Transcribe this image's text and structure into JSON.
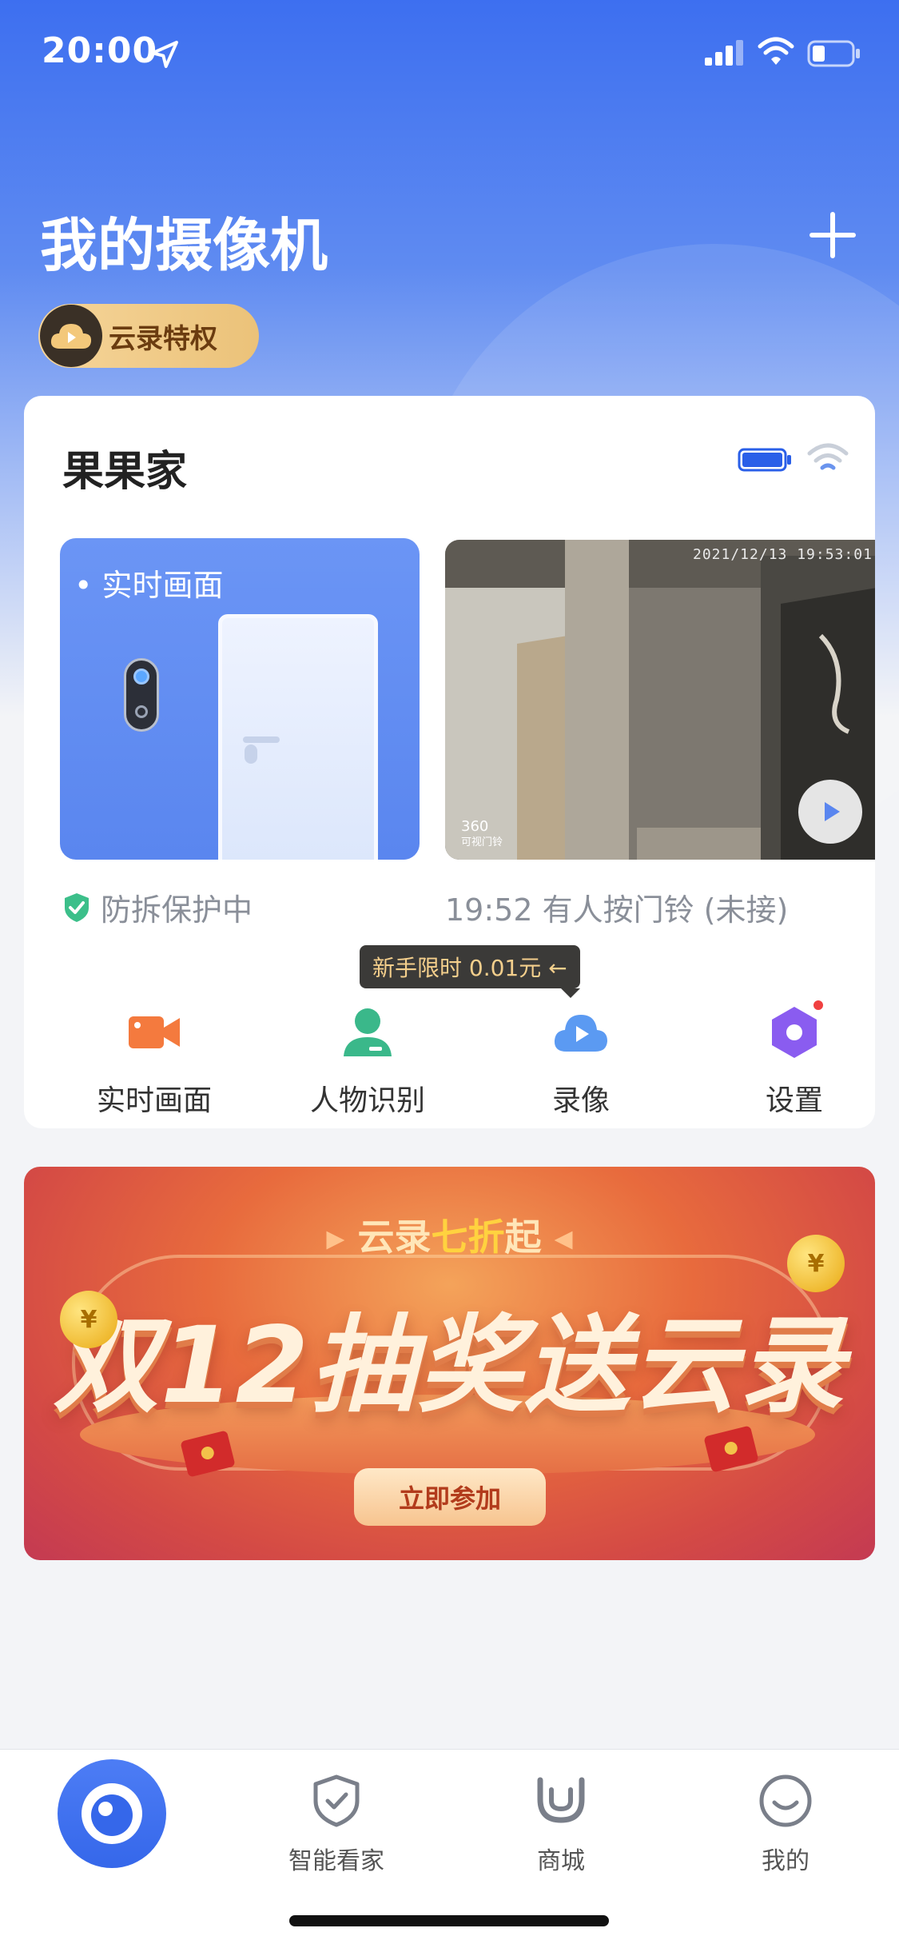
{
  "status_bar": {
    "time": "20:00"
  },
  "header": {
    "title": "我的摄像机",
    "cloud_badge": "云录特权"
  },
  "camera": {
    "name": "果果家",
    "live_tile_label": "实时画面",
    "protect_status": "防拆保护中",
    "last_event": "19:52 有人按门铃 (未接)",
    "recording_timestamp": "2021/12/13 19:53:01",
    "recording_brand_top": "360",
    "recording_brand_bottom": "可视门铃",
    "promo_tooltip": "新手限时 0.01元 ←",
    "features": [
      {
        "label": "实时画面",
        "icon": "video-camera-icon"
      },
      {
        "label": "人物识别",
        "icon": "person-icon"
      },
      {
        "label": "录像",
        "icon": "cloud-play-icon"
      },
      {
        "label": "设置",
        "icon": "settings-hex-icon"
      }
    ]
  },
  "banner": {
    "subtitle_prefix": "云录",
    "subtitle_highlight": "七折",
    "subtitle_suffix": "起",
    "title": "双12抽奖送云录",
    "button": "立即参加"
  },
  "tab_bar": {
    "items": [
      {
        "label": "",
        "icon": "eye-icon",
        "active": true
      },
      {
        "label": "智能看家",
        "icon": "shield-check-icon"
      },
      {
        "label": "商城",
        "icon": "mall-icon"
      },
      {
        "label": "我的",
        "icon": "smile-icon"
      }
    ]
  },
  "colors": {
    "accent": "#3d6ff0",
    "badge_gold": "#ebc279",
    "tooltip_text": "#f4cf8c",
    "protect_green": "#3cbf8a"
  }
}
